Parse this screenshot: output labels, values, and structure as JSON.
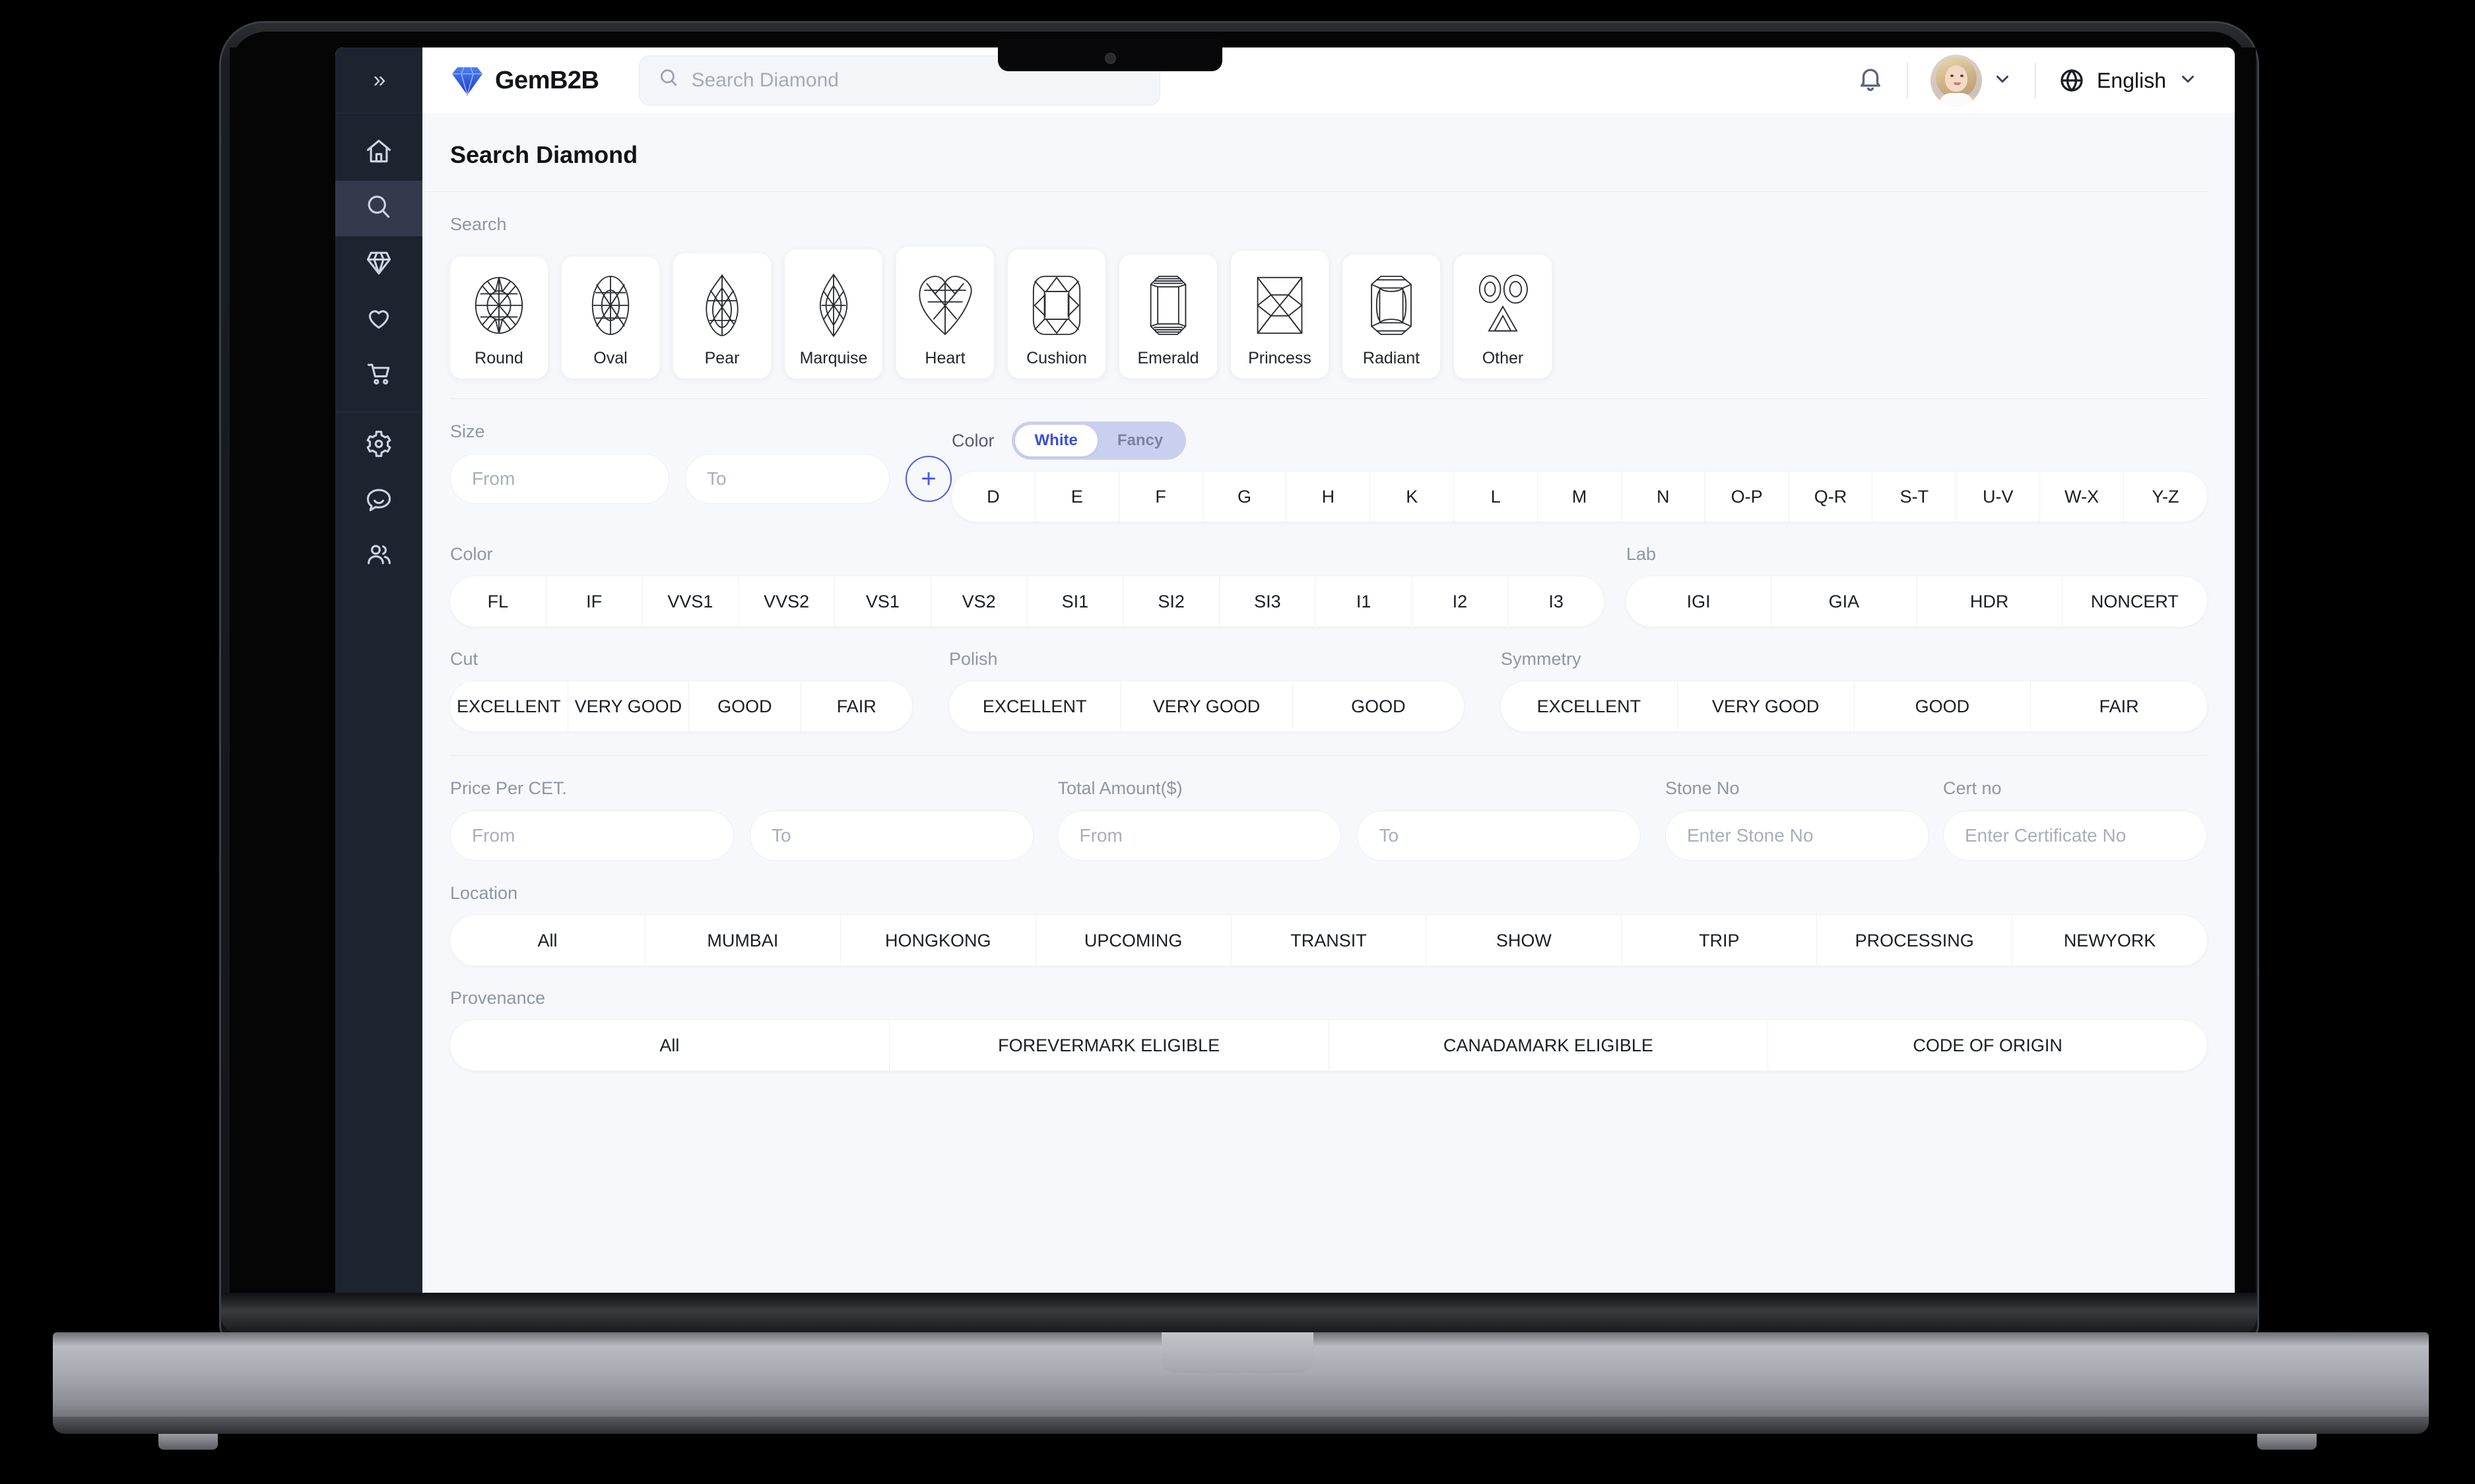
{
  "sidebar": {
    "collapse_label": "»",
    "items": [
      {
        "icon": "home-icon",
        "name": "home"
      },
      {
        "icon": "search-icon",
        "name": "search",
        "active": true
      },
      {
        "icon": "diamond-icon",
        "name": "diamond"
      },
      {
        "icon": "heart-icon",
        "name": "wishlist"
      },
      {
        "icon": "cart-icon",
        "name": "cart"
      }
    ],
    "items_bottom": [
      {
        "icon": "gear-icon",
        "name": "settings"
      },
      {
        "icon": "chat-icon",
        "name": "messages"
      },
      {
        "icon": "users-icon",
        "name": "users"
      }
    ]
  },
  "header": {
    "brand_name": "GemB2B",
    "search_placeholder": "Search Diamond",
    "notification_icon": "bell-icon",
    "avatar_icon": "avatar",
    "avatar_chevron": "chevron-down-icon",
    "language_icon": "globe-icon",
    "language_label": "English",
    "language_chevron": "chevron-down-icon"
  },
  "page": {
    "title": "Search Diamond"
  },
  "search_section": {
    "label": "Search",
    "shapes": [
      {
        "label": "Round",
        "icon": "round-diamond-icon"
      },
      {
        "label": "Oval",
        "icon": "oval-diamond-icon"
      },
      {
        "label": "Pear",
        "icon": "pear-diamond-icon"
      },
      {
        "label": "Marquise",
        "icon": "marquise-diamond-icon"
      },
      {
        "label": "Heart",
        "icon": "heart-diamond-icon"
      },
      {
        "label": "Cushion",
        "icon": "cushion-diamond-icon"
      },
      {
        "label": "Emerald",
        "icon": "emerald-diamond-icon"
      },
      {
        "label": "Princess",
        "icon": "princess-diamond-icon"
      },
      {
        "label": "Radiant",
        "icon": "radiant-diamond-icon"
      },
      {
        "label": "Other",
        "icon": "other-diamond-icon"
      }
    ]
  },
  "size": {
    "label": "Size",
    "from_placeholder": "From",
    "to_placeholder": "To",
    "add_button": "+"
  },
  "color_toggle": {
    "label": "Color",
    "options": [
      "White",
      "Fancy"
    ],
    "selected": "White"
  },
  "color_grades": {
    "items": [
      "D",
      "E",
      "F",
      "G",
      "H",
      "K",
      "L",
      "M",
      "N",
      "O-P",
      "Q-R",
      "S-T",
      "U-V",
      "W-X",
      "Y-Z"
    ]
  },
  "clarity": {
    "label": "Color",
    "items": [
      "FL",
      "IF",
      "VVS1",
      "VVS2",
      "VS1",
      "VS2",
      "SI1",
      "SI2",
      "SI3",
      "I1",
      "I2",
      "I3"
    ]
  },
  "lab": {
    "label": "Lab",
    "items": [
      "IGI",
      "GIA",
      "HDR",
      "NONCERT"
    ]
  },
  "cut": {
    "label": "Cut",
    "items": [
      "EXCELLENT",
      "VERY GOOD",
      "GOOD",
      "FAIR"
    ]
  },
  "polish": {
    "label": "Polish",
    "items": [
      "EXCELLENT",
      "VERY GOOD",
      "GOOD"
    ]
  },
  "symmetry": {
    "label": "Symmetry",
    "items": [
      "EXCELLENT",
      "VERY GOOD",
      "GOOD",
      "FAIR"
    ]
  },
  "price_per_ct": {
    "label": "Price Per CET.",
    "from_placeholder": "From",
    "to_placeholder": "To"
  },
  "total_amount": {
    "label": "Total Amount($)",
    "from_placeholder": "From",
    "to_placeholder": "To"
  },
  "stone_no": {
    "label": "Stone No",
    "placeholder": "Enter Stone No"
  },
  "cert_no": {
    "label": "Cert no",
    "placeholder": "Enter Certificate No"
  },
  "location": {
    "label": "Location",
    "items": [
      "All",
      "MUMBAI",
      "HONGKONG",
      "UPCOMING",
      "TRANSIT",
      "SHOW",
      "TRIP",
      "PROCESSING",
      "NEWYORK"
    ]
  },
  "provenance": {
    "label": "Provenance",
    "items": [
      "All",
      "FOREVERMARK ELIGIBLE",
      "CANADAMARK ELIGIBLE",
      "CODE OF ORIGIN"
    ]
  },
  "colors": {
    "accent": "#3b4fd8",
    "sidebar_bg": "#1e2330",
    "page_bg": "#f7f8fb"
  }
}
